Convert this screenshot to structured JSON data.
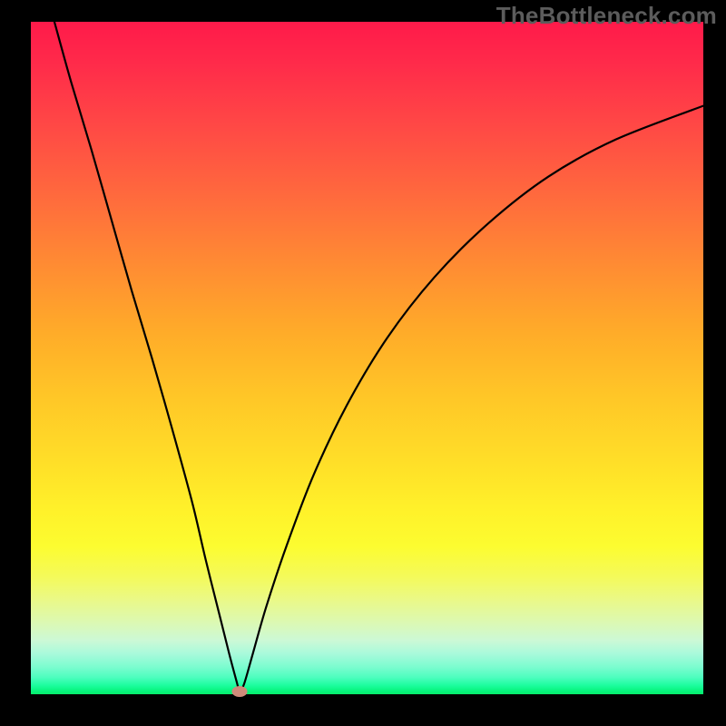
{
  "watermark": "TheBottleneck.com",
  "colors": {
    "page_bg": "#000000",
    "curve_stroke": "#000000",
    "dot_fill": "#cf8b7a"
  },
  "chart_data": {
    "type": "line",
    "title": "",
    "xlabel": "",
    "ylabel": "",
    "xlim": [
      0,
      100
    ],
    "ylim": [
      0,
      100
    ],
    "grid": false,
    "legend": false,
    "series": [
      {
        "name": "bottleneck-curve",
        "x": [
          3.5,
          6,
          9,
          12,
          15,
          18,
          21,
          24,
          26,
          28,
          29.5,
          30.7,
          31,
          31.7,
          33,
          35,
          38,
          42,
          47,
          53,
          60,
          68,
          77,
          87,
          100
        ],
        "y": [
          100,
          91,
          81,
          70.5,
          60,
          50,
          39.5,
          28.5,
          20,
          12,
          6,
          1.5,
          0.4,
          1.5,
          6,
          13,
          22,
          32.5,
          43,
          53,
          62,
          70,
          77,
          82.5,
          87.5
        ]
      }
    ],
    "marker": {
      "x": 31,
      "y": 0.4
    }
  }
}
